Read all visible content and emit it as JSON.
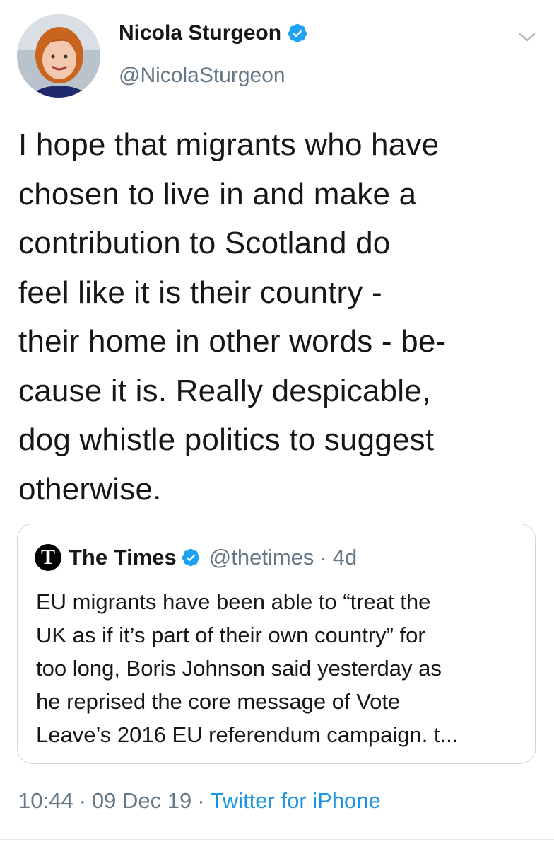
{
  "author": {
    "display_name": "Nicola Sturgeon",
    "handle": "@NicolaSturgeon",
    "verified_icon": "verified-badge-icon",
    "avatar_icon": "profile-photo"
  },
  "tweet": {
    "text": "I hope that migrants who have\nchosen to live in and make a\ncontribution to Scotland do\nfeel like it is their country -\ntheir home in other words - be-\ncause it is. Really despicable,\ndog whistle politics to suggest\notherwise."
  },
  "quoted_tweet": {
    "logo_letter": "T",
    "name": "The Times",
    "handle": "@thetimes",
    "separator": "·",
    "age": "4d",
    "text": "EU migrants have been able to “treat the\nUK as if it’s part of their own country” for\ntoo long, Boris Johnson said yesterday as\nhe reprised the core message of Vote\nLeave’s 2016 EU referendum campaign. t..."
  },
  "meta": {
    "time": "10:44",
    "separator": "·",
    "date": "09 Dec 19",
    "source": "Twitter for iPhone"
  },
  "colors": {
    "text": "#14171a",
    "secondary": "#657786",
    "link": "#1b95e0",
    "verified": "#1da1f2",
    "border": "#ccd6dd"
  }
}
